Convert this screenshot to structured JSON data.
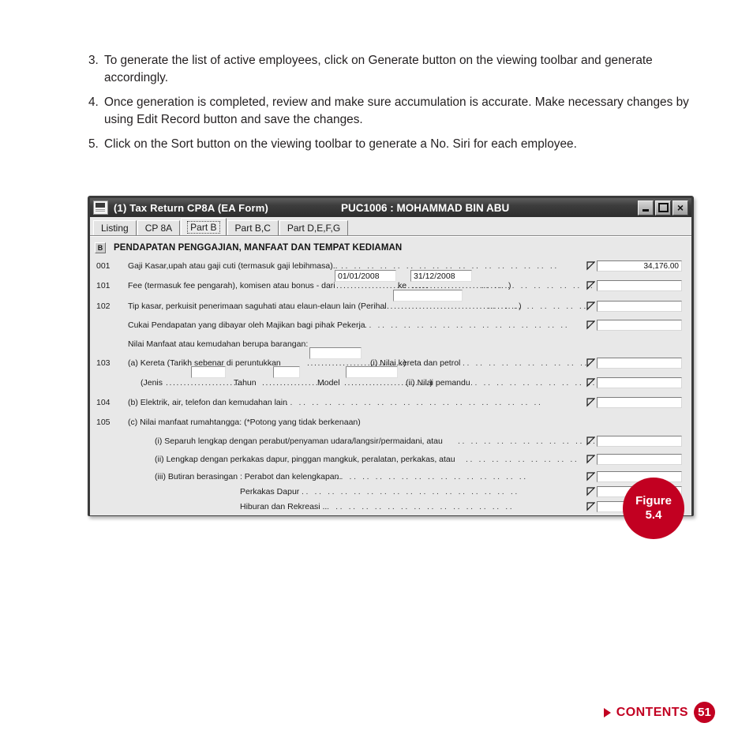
{
  "instructions": [
    {
      "num": "3.",
      "text": "To generate the list of active employees, click on Generate button on the viewing toolbar and generate accordingly."
    },
    {
      "num": "4.",
      "text": "Once generation is completed, review and make sure accumulation is accurate. Make necessary changes by using Edit Record button and save the changes."
    },
    {
      "num": "5.",
      "text": "Click on the Sort button on the viewing toolbar to generate a No. Siri for each employee."
    }
  ],
  "window": {
    "title": "(1)  Tax Return CP8A  (EA  Form)",
    "document": "PUC1006 : MOHAMMAD BIN ABU",
    "buttons": {
      "minimize": "minimize-icon",
      "maximize": "maximize-icon",
      "close": "×"
    },
    "tabs": [
      {
        "label": "Listing",
        "active": false
      },
      {
        "label": "CP 8A",
        "active": false
      },
      {
        "label": "Part B",
        "active": true
      },
      {
        "label": "Part B,C",
        "active": false
      },
      {
        "label": "Part D,E,F,G",
        "active": false
      }
    ],
    "section": {
      "button": "B",
      "title": "PENDAPATAN PENGGAJIAN, MANFAAT DAN TEMPAT KEDIAMAN"
    },
    "rows": [
      {
        "code": "001",
        "label": "Gaji Kasar,upah atau gaji cuti (termasuk gaji lebihmasa)..",
        "trail": ".. .. ..  ..  ..  ..  ..  ..  ..  ..  ..  ..  ..  ..  ..  ..  ..",
        "value": "34,176.00"
      },
      {
        "code": "101",
        "label": "Fee (termasuk fee pengarah), komisen atau bonus - dari",
        "mid1": "..........................",
        "mid_word": "ke",
        "mid2": "...........................)",
        "trail": ".. .. .. .. .. .. .. .. .. ..",
        "value": "",
        "field_from": "01/01/2008",
        "field_to": "31/12/2008"
      },
      {
        "code": "102",
        "label": "Tip kasar, perkuisit penerimaan saguhati atau elaun-elaun lain (Perihal",
        "mid2": ".......................................)",
        "trail": "..  ..  ..  ..  ..  ..  ..  ..",
        "value": "",
        "field_perihal": ""
      },
      {
        "code": "",
        "label": "Cukai Pendapatan yang dibayar oleh Majikan bagi pihak Pekerja",
        "trail": "..  ..  ..  ..  ..  ..  ..  ..  ..  ..  ..  ..  ..  ..  ..  ..",
        "value": ""
      },
      {
        "code": "",
        "label": "Nilai Manfaat atau kemudahan berupa barangan:",
        "trail": "",
        "value": null
      },
      {
        "code": "103",
        "label": "(a) Kereta (Tarikh sebenar di peruntukkan",
        "mid2": "...........................)",
        "sub": "(i) Nilai kereta dan petrol",
        "trail": "..  ..  ..  ..  ..  ..  ..  ..  ..  ..",
        "value": "",
        "field_tarikh": ""
      },
      {
        "code": "",
        "label": "(Jenis",
        "label2": "Tahun",
        "label3": "Model",
        "mid1": ".....................",
        "mid2": "..................",
        "mid3": "........................)",
        "sub": "(ii) Nilai pemandu",
        "trail": "..  ..  ..  ..  ..  ..  ..  ..  ..  ..  ..",
        "value": ""
      },
      {
        "code": "104",
        "label": "(b) Elektrik, air, telefon dan kemudahan lain",
        "trail": "..  ..  ..  ..  ..  ..  ..  ..  ..  ..  ..  ..  ..  ..  ..  ..  ..  ..  ..  ..",
        "value": ""
      },
      {
        "code": "105",
        "label": "(c) Nilai manfaat rumahtangga:    (*Potong yang tidak berkenaan)",
        "trail": "",
        "value": null
      },
      {
        "code": "",
        "label": "(i) Separuh lengkap dengan perabut/penyaman udara/langsir/permaidani, atau",
        "trail": "..  ..  ..  ..  ..  ..  ..  ..  ..  ..  ..",
        "value": ""
      },
      {
        "code": "",
        "label": "(ii) Lengkap dengan perkakas dapur, pinggan mangkuk, peralatan, perkakas, atau",
        "trail": "..  ..  ..  ..  ..  ..  ..  ..  ..",
        "value": ""
      },
      {
        "code": "",
        "label": "(iii) Butiran berasingan :  Perabot dan kelengkapan.",
        "trail": "..  ..  ..  ..  ..  ..  ..  ..  ..  ..  ..  ..  ..  ..  ..",
        "value": ""
      },
      {
        "code": "",
        "label": "Perkakas Dapur",
        "trail": "..  ..  ..  ..  ..  ..  ..  ..  ..  ..  ..  ..  ..  ..  ..  ..  ..",
        "value": ""
      },
      {
        "code": "",
        "label": "Hiburan dan Rekreasi ..",
        "trail": "..  ..  ..  ..  ..  ..  ..  ..  ..  ..  ..  ..  ..  ..  ..  ..",
        "value": ""
      }
    ]
  },
  "figure": {
    "caption": "Figure",
    "number": "5.4"
  },
  "footer": {
    "contents": "CONTENTS",
    "page": "51"
  },
  "colors": {
    "brand_red": "#c20021",
    "title_bar": "#3d3d3d",
    "window_bg": "#e8e8e8"
  }
}
